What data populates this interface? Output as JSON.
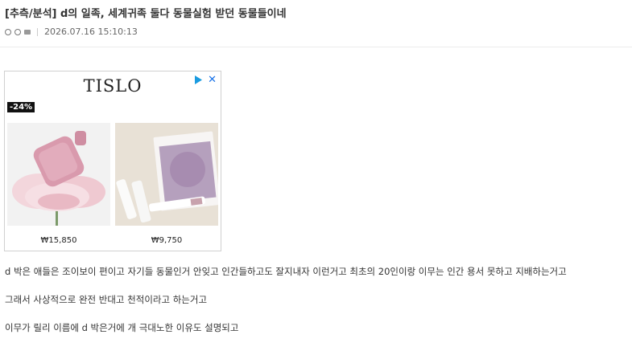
{
  "post": {
    "title": "[추측/분석] d의 일족, 세계귀족 둘다 동물실험 받던 동물들이네",
    "datetime": "2026.07.16 15:10:13"
  },
  "ad": {
    "brand": "TISLO",
    "discount": "-24%",
    "products": [
      {
        "price": "₩15,850"
      },
      {
        "price": "₩9,750"
      }
    ]
  },
  "body": {
    "paragraphs": [
      "d 박은 애들은 조이보이 편이고 자기들 동물인거 안잊고 인간들하고도 잘지내자 이런거고 최초의 20인이랑 이무는 인간 용서 못하고 지배하는거고",
      "그래서 사상적으로 완전 반대고 천적이라고 하는거고",
      "이무가 릴리 이름에 d 박은거에 개 극대노한 이유도 설명되고"
    ]
  }
}
